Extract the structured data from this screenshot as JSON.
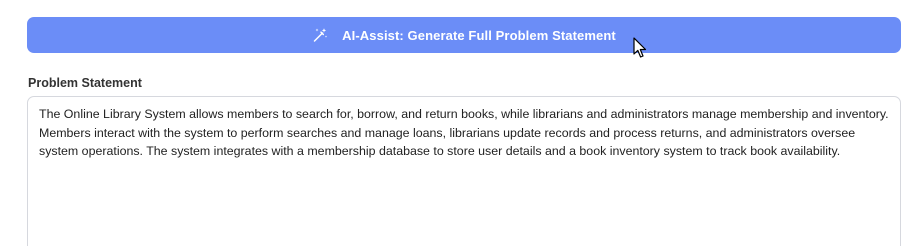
{
  "ai_assist": {
    "label": "AI-Assist: Generate Full Problem Statement",
    "icon": "magic-wand-icon",
    "color": "#6b8df7"
  },
  "problem_statement": {
    "label": "Problem Statement",
    "value": "The Online Library System allows members to search for, borrow, and return books, while librarians and administrators manage membership and inventory. Members interact with the system to perform searches and manage loans, librarians update records and process returns, and administrators oversee system operations. The system integrates with a membership database to store user details and a book inventory system to track book availability."
  }
}
